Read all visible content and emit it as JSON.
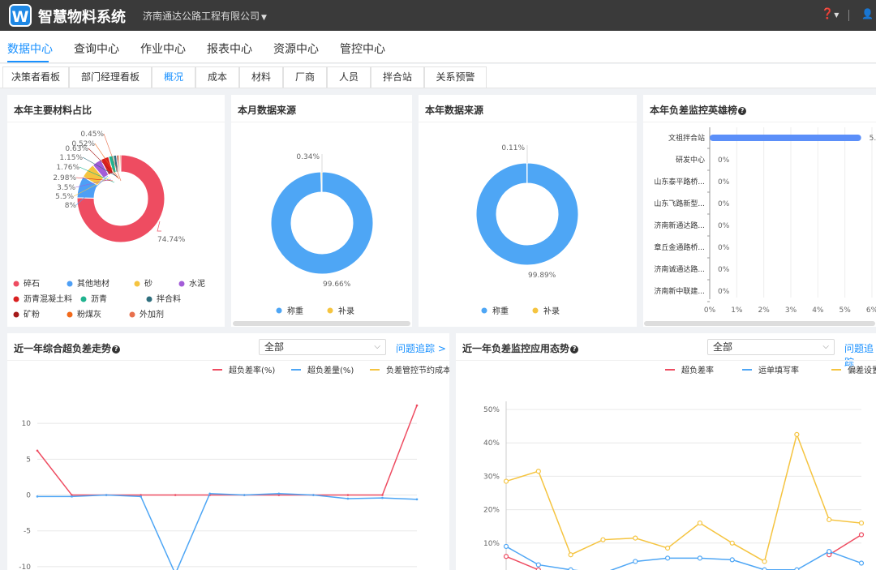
{
  "header": {
    "logo_letter": "W",
    "app_title": "智慧物料系统",
    "company": "济南通达公路工程有限公司",
    "help_icon": "question-circle-icon",
    "user_icon": "user-icon"
  },
  "nav": [
    "数据中心",
    "查询中心",
    "作业中心",
    "报表中心",
    "资源中心",
    "管控中心"
  ],
  "tabs": [
    "决策者看板",
    "部门经理看板",
    "概况",
    "成本",
    "材料",
    "厂商",
    "人员",
    "拌合站",
    "关系预警"
  ],
  "active_tab": "概况",
  "cards": {
    "materials": {
      "title": "本年主要材料占比",
      "chart_data": {
        "type": "pie",
        "style": "donut",
        "slices": [
          {
            "name": "碎石",
            "value": 74.74,
            "label": "74.74%",
            "color": "#ee4c61"
          },
          {
            "name": "其他地材",
            "value": 8,
            "label": "8%",
            "color": "#4e9ff5"
          },
          {
            "name": "砂",
            "value": 5.5,
            "label": "5.5%",
            "color": "#f5c440"
          },
          {
            "name": "水泥",
            "value": 3.5,
            "label": "3.5%",
            "color": "#a35dd8"
          },
          {
            "name": "沥青混凝土料",
            "value": 2.98,
            "label": "2.98%",
            "color": "#d92020"
          },
          {
            "name": "沥青",
            "value": 1.76,
            "label": "1.76%",
            "color": "#21b38f"
          },
          {
            "name": "拌合料",
            "value": 1.15,
            "label": "1.15%",
            "color": "#2f6f7e"
          },
          {
            "name": "矿粉",
            "value": 0.63,
            "label": "0.63%",
            "color": "#a51a1a"
          },
          {
            "name": "粉煤灰",
            "value": 0.52,
            "label": "0.52%",
            "color": "#f26a1b"
          },
          {
            "name": "外加剂",
            "value": 0.45,
            "label": "0.45%",
            "color": "#e8704d"
          }
        ]
      }
    },
    "month_source": {
      "title": "本月数据来源",
      "chart_data": {
        "type": "pie",
        "style": "donut",
        "slices": [
          {
            "name": "称重",
            "value": 99.66,
            "label": "99.66%",
            "color": "#4ea6f5"
          },
          {
            "name": "补录",
            "value": 0.34,
            "label": "0.34%",
            "color": "#f5c440"
          }
        ]
      }
    },
    "year_source": {
      "title": "本年数据来源",
      "chart_data": {
        "type": "pie",
        "style": "donut",
        "slices": [
          {
            "name": "称重",
            "value": 99.89,
            "label": "99.89%",
            "color": "#4ea6f5"
          },
          {
            "name": "补录",
            "value": 0.11,
            "label": "0.11%",
            "color": "#f5c440"
          }
        ]
      }
    },
    "ranking": {
      "title": "本年负差监控英雄榜",
      "chart_data": {
        "type": "bar",
        "orientation": "horizontal",
        "categories": [
          "文祖拌合站",
          "研发中心",
          "山东泰平路桥...",
          "山东飞路新型...",
          "济南新通达路...",
          "章丘金通路桥...",
          "济南诚通达路...",
          "济南新中联建..."
        ],
        "values": [
          5.6,
          0,
          0,
          0,
          0,
          0,
          0,
          0
        ],
        "value_labels": [
          "5.",
          "0%",
          "0%",
          "0%",
          "0%",
          "0%",
          "0%",
          "0%"
        ],
        "xticks": [
          "0%",
          "1%",
          "2%",
          "3%",
          "4%",
          "5%",
          "6%"
        ],
        "xlim": [
          0,
          6
        ],
        "color": "#5b8ff9"
      }
    },
    "trend": {
      "title": "近一年综合超负差走势",
      "select_value": "全部",
      "link": "问题追踪 >",
      "chart_data": {
        "type": "line",
        "series": [
          {
            "name": "超负差率(%)",
            "color": "#ee4c61",
            "values": [
              6.2,
              0,
              0,
              0,
              0,
              0,
              0,
              0,
              0,
              0,
              0,
              12.5
            ]
          },
          {
            "name": "超负差量(%)",
            "color": "#4ea6f5",
            "values": [
              -0.2,
              -0.2,
              0,
              -0.2,
              -11,
              0.2,
              0,
              0.2,
              0,
              -0.5,
              -0.4,
              -0.6
            ]
          },
          {
            "name": "负差管控节约成本",
            "color": "#f5c440",
            "values": []
          }
        ],
        "yticks": [
          "10",
          "5",
          "0",
          "-5",
          "-10"
        ],
        "ylim": [
          -11.8,
          14.5
        ]
      }
    },
    "app_trend": {
      "title": "近一年负差监控应用态势",
      "select_value": "全部",
      "link": "问题追踪",
      "chart_data": {
        "type": "line",
        "series": [
          {
            "name": "超负差率",
            "color": "#ee4c61",
            "values": [
              6,
              2,
              null,
              null,
              null,
              null,
              null,
              null,
              null,
              null,
              6.5,
              12.5
            ]
          },
          {
            "name": "运单填写率",
            "color": "#4ea6f5",
            "values": [
              9,
              3.5,
              2,
              1,
              4.5,
              5.5,
              5.5,
              5,
              2,
              2,
              7.5,
              4
            ]
          },
          {
            "name": "偏差设置",
            "color": "#f5c440",
            "values": [
              28.5,
              31.5,
              6.5,
              11,
              11.5,
              8.5,
              16,
              10,
              4.5,
              42.5,
              17,
              16
            ]
          }
        ],
        "yticks": [
          "50%",
          "40%",
          "30%",
          "20%",
          "10%"
        ],
        "ylim": [
          0,
          50
        ]
      }
    }
  }
}
